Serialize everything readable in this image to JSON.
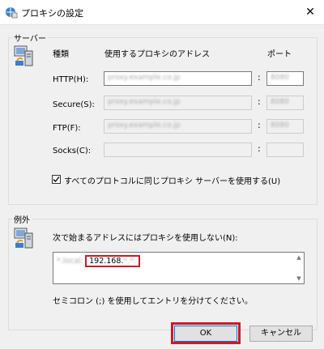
{
  "window": {
    "title": "プロキシの設定",
    "close_glyph": "✕"
  },
  "servers": {
    "group_label": "サーバー",
    "col_type": "種類",
    "col_address": "使用するプロキシのアドレス",
    "col_port": "ポート",
    "rows": [
      {
        "label": "HTTP(H):",
        "address": "proxy.example.co.jp",
        "port": "8080",
        "enabled": true
      },
      {
        "label": "Secure(S):",
        "address": "proxy.example.co.jp",
        "port": "8080",
        "enabled": false
      },
      {
        "label": "FTP(F):",
        "address": "proxy.example.co.jp",
        "port": "8080",
        "enabled": false
      },
      {
        "label": "Socks(C):",
        "address": "",
        "port": "",
        "enabled": false
      }
    ],
    "colon": ":",
    "same_proxy_label": "すべてのプロトコルに同じプロキシ サーバーを使用する(U)",
    "same_proxy_checked": true
  },
  "exceptions": {
    "group_label": "例外",
    "instruction": "次で始まるアドレスにはプロキシを使用しない(N):",
    "value_prefix": "*.local;",
    "value_highlight": "192.168.",
    "value_highlight_rest": "*.*;",
    "note": "セミコロン (;) を使用してエントリを分けてください。"
  },
  "buttons": {
    "ok": "OK",
    "cancel": "キャンセル"
  },
  "colors": {
    "highlight": "#cc1a28",
    "accent": "#0078d7"
  }
}
